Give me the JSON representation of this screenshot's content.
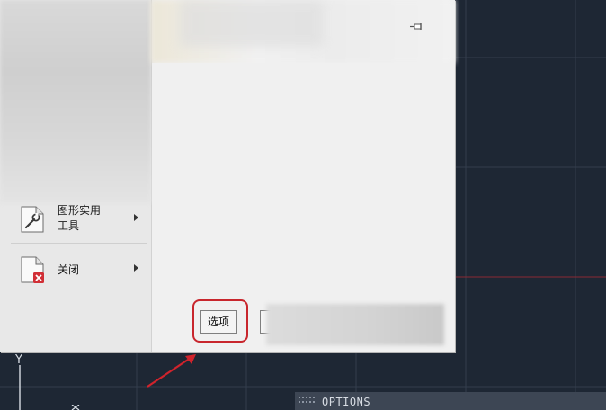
{
  "app_menu": {
    "items": [
      {
        "label_line1": "图形实用",
        "label_line2": "工具",
        "icon": "wrench-icon"
      },
      {
        "label_line1": "关闭",
        "label_line2": "",
        "icon": "close-drawing-icon"
      }
    ],
    "options_button": "选项",
    "pin_icon": "pin-icon"
  },
  "command_line": {
    "text": "OPTIONS"
  },
  "ucs": {
    "y_label": "Y"
  },
  "colors": {
    "canvas_bg": "#1e2734",
    "grid_line": "#3a4454",
    "highlight": "#c8262d",
    "red_axis": "#b0242f"
  }
}
